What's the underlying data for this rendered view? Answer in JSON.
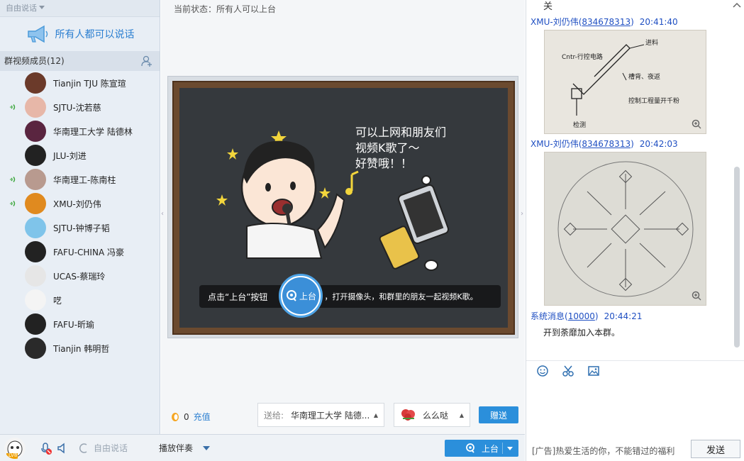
{
  "left": {
    "mode_label": "自由说话",
    "announce": "所有人都可以说话",
    "members_title": "群视频成员(12)",
    "members": [
      {
        "name": "Tianjin TJU 陈宣瑄",
        "speaking": false,
        "avatar_color": "#6b3a2a"
      },
      {
        "name": "SJTU-沈若慈",
        "speaking": true,
        "avatar_color": "#e7b7a8"
      },
      {
        "name": "华南理工大学 陆德林",
        "speaking": false,
        "avatar_color": "#5a2540"
      },
      {
        "name": "JLU-刘进",
        "speaking": false,
        "avatar_color": "#222222"
      },
      {
        "name": "华南理工-陈南柱",
        "speaking": true,
        "avatar_color": "#b89a8f"
      },
      {
        "name": "XMU-刘仍伟",
        "speaking": true,
        "avatar_color": "#e08a1f"
      },
      {
        "name": "SJTU-钟博子韬",
        "speaking": false,
        "avatar_color": "#7fc4ea"
      },
      {
        "name": "FAFU-CHINA 冯豪",
        "speaking": false,
        "avatar_color": "#222222"
      },
      {
        "name": "UCAS-蔡瑞玲",
        "speaking": false,
        "avatar_color": "#e6e6e6"
      },
      {
        "name": "呓",
        "speaking": false,
        "avatar_color": "#f4f4f4"
      },
      {
        "name": "FAFU-昕瑜",
        "speaking": false,
        "avatar_color": "#222222"
      },
      {
        "name": "Tianjin 韩明哲",
        "speaking": false,
        "avatar_color": "#2a2a2a"
      }
    ]
  },
  "bottom": {
    "free_talk": "自由说话",
    "accompany": "播放伴奏",
    "stage_btn": "上台"
  },
  "center": {
    "status": "当前状态：所有人可以上台",
    "board_text_1": "可以上网和朋友们",
    "board_text_2": "视频K歌了～",
    "board_text_3": "好赞哦！！",
    "hint_left": "点击“上台”按钮",
    "hint_btn": "上台",
    "hint_right": "，打开摄像头，和群里的朋友一起视频K歌。",
    "coin_count": "0",
    "recharge": "充值",
    "send_to_label": "送给:",
    "send_to_value": "华南理工大学 陆德...",
    "gift_name": "么么哒",
    "gift_btn": "赠送"
  },
  "right": {
    "top_char": "关",
    "messages": [
      {
        "sender": "XMU-刘仍伟(",
        "id": "834678313",
        "close": ")",
        "time": "20:41:40"
      },
      {
        "sender": "XMU-刘仍伟(",
        "id": "834678313",
        "close": ")",
        "time": "20:42:03"
      },
      {
        "sender": "系统消息(",
        "id": "10000",
        "close": ")",
        "time": "20:44:21",
        "text": "开到荼靡加入本群。"
      }
    ],
    "sketch_1_labels": [
      "Cntr-行控电路",
      "进料",
      "槽背、夜返",
      "控制工程量开千粉",
      "检测"
    ],
    "ad_text": "[广告]热爱生活的你，不能错过的福利",
    "send_btn": "发送"
  },
  "colors": {
    "accent": "#2b8fdb",
    "link": "#1f4fc2",
    "speaking": "#3aa63a"
  }
}
